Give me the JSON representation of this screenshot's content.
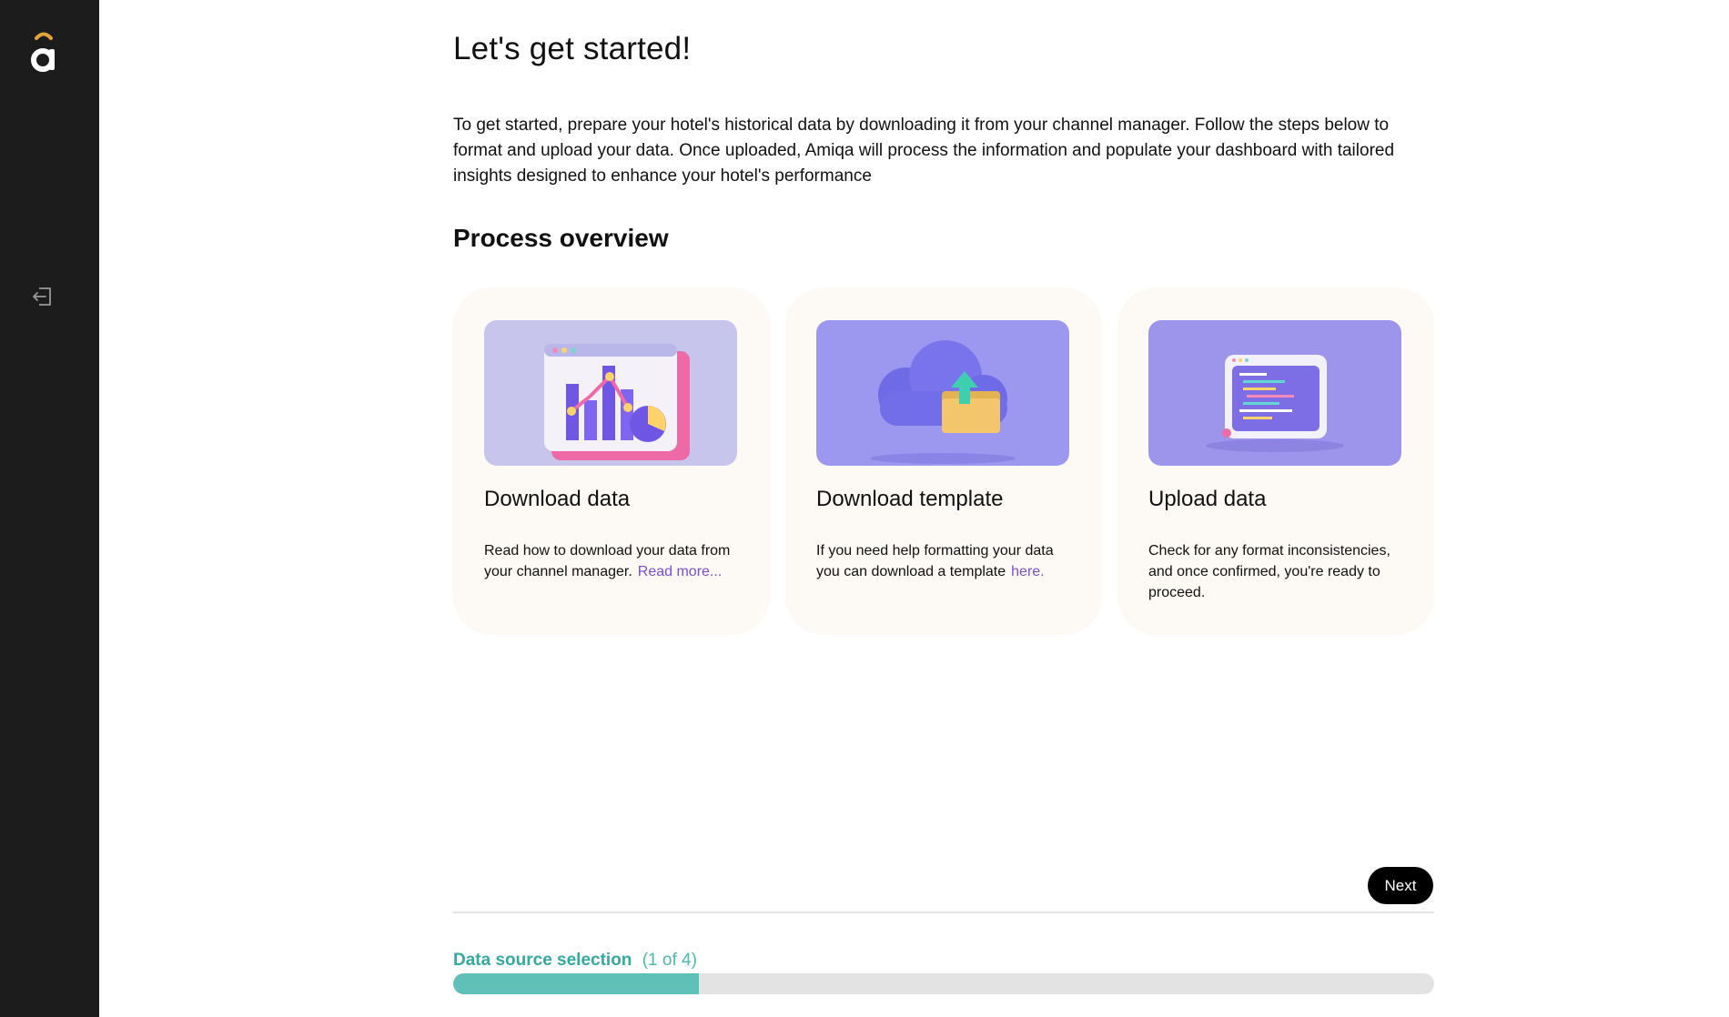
{
  "main": {
    "title": "Let's get started!",
    "intro": "To get started, prepare your hotel's historical data by downloading it from your channel manager. Follow the steps below to format and upload your data. Once uploaded, Amiqa will process the information and populate your dashboard with tailored insights designed to enhance your hotel's performance",
    "section_title": "Process overview",
    "cards": [
      {
        "title": "Download data",
        "text": "Read how to download your data from your channel manager.",
        "link": "Read more..."
      },
      {
        "title": "Download template",
        "text": "If you need help formatting your data you can download a template",
        "link": "here."
      },
      {
        "title": "Upload data",
        "text": "Check for any format inconsistencies, and once confirmed, you're ready to proceed.",
        "link": ""
      }
    ],
    "next_label": "Next"
  },
  "progress": {
    "step_label": "Data source selection",
    "step_count": "(1 of 4)",
    "fraction": 0.25
  },
  "icons": {
    "logo": "amiqa-logo",
    "logout": "logout-icon"
  },
  "colors": {
    "sidebar": "#1c1c1c",
    "accent": "#5ec0b6",
    "link": "#7b4fd0",
    "card_bg": "#fdf9f4"
  }
}
